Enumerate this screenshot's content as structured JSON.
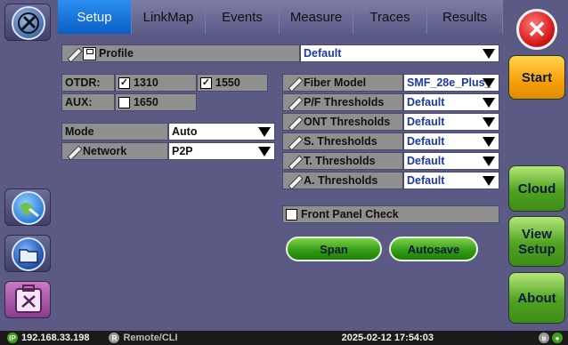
{
  "tabs": [
    "Setup",
    "LinkMap",
    "Events",
    "Measure",
    "Traces",
    "Results"
  ],
  "active_tab": "Setup",
  "profile": {
    "label": "Profile",
    "value": "Default"
  },
  "otdr": {
    "label": "OTDR:",
    "wl1": "1310",
    "wl1_checked": true,
    "wl2": "1550",
    "wl2_checked": true
  },
  "aux": {
    "label": "AUX:",
    "wl": "1650",
    "checked": false
  },
  "mode": {
    "label": "Mode",
    "value": "Auto"
  },
  "network": {
    "label": "Network",
    "value": "P2P"
  },
  "settings": [
    {
      "label": "Fiber Model",
      "value": "SMF_28e_Plus_"
    },
    {
      "label": "P/F Thresholds",
      "value": "Default"
    },
    {
      "label": "ONT Thresholds",
      "value": "Default"
    },
    {
      "label": "S. Thresholds",
      "value": "Default"
    },
    {
      "label": "T. Thresholds",
      "value": "Default"
    },
    {
      "label": "A. Thresholds",
      "value": "Default"
    }
  ],
  "front_panel_check": {
    "label": "Front Panel Check",
    "checked": false
  },
  "buttons": {
    "span": "Span",
    "autosave": "Autosave"
  },
  "right_rail": {
    "start": "Start",
    "cloud": "Cloud",
    "view_setup_line1": "View",
    "view_setup_line2": "Setup",
    "about": "About"
  },
  "status": {
    "ip_badge": "IP",
    "ip": "192.168.33.198",
    "remote_badge": "R",
    "remote": "Remote/CLI",
    "datetime": "2025-02-12  17:54:03"
  },
  "colors": {
    "active_tab": "#0a5fc4",
    "green_button": "#4fa320",
    "start_button": "#f5a00a",
    "close_button": "#d41616"
  }
}
